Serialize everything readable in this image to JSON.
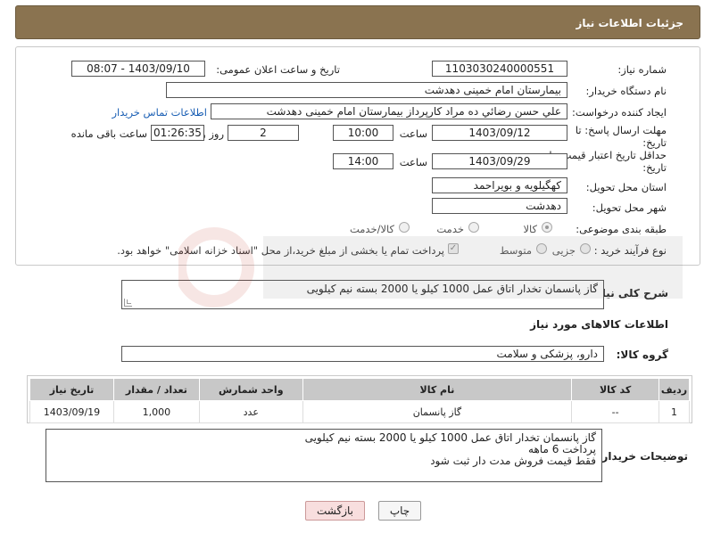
{
  "header": {
    "title": "جزئیات اطلاعات نیاز"
  },
  "form": {
    "need_number_label": "شماره نیاز:",
    "need_number": "1103030240000551",
    "announce_label": "تاریخ و ساعت اعلان عمومی:",
    "announce_value": "1403/09/10 - 08:07",
    "buyer_org_label": "نام دستگاه خریدار:",
    "buyer_org": "بیمارستان امام خمینی دهدشت",
    "creator_label": "ایجاد کننده درخواست:",
    "creator": "علي حسن رضائي ده مراد کارپرداز بیمارستان امام خمینی دهدشت",
    "contact_link": "اطلاعات تماس خریدار",
    "deadline_label": "مهلت ارسال پاسخ: تا",
    "deadline_label2": "تاریخ:",
    "deadline_date": "1403/09/12",
    "time_label": "ساعت",
    "deadline_time": "10:00",
    "days_value": "2",
    "days_label": "روز و",
    "remaining_time": "01:26:35",
    "remaining_label": "ساعت باقی مانده",
    "validity_label": "حداقل تاریخ اعتبار قیمت: تا",
    "validity_label2": "تاریخ:",
    "validity_date": "1403/09/29",
    "validity_time_label": "ساعت",
    "validity_time": "14:00",
    "province_label": "استان محل تحویل:",
    "province": "کهگیلویه و بویراحمد",
    "city_label": "شهر محل تحویل:",
    "city": "دهدشت",
    "category_label": "طبقه بندی موضوعی:",
    "category_options": [
      "کالا",
      "خدمت",
      "کالا/خدمت"
    ],
    "category_selected": "کالا",
    "process_label": "نوع فرآیند خرید :",
    "process_options": [
      "جزیی",
      "متوسط"
    ],
    "payment_note": "پرداخت تمام یا بخشی از مبلغ خرید،از محل \"اسناد خزانه اسلامی\" خواهد بود."
  },
  "description": {
    "label": "شرح کلی نیاز:",
    "text": "گاز پانسمان تخدار اتاق عمل 1000 کیلو یا 2000 بسته نیم کیلویی"
  },
  "goods_section": {
    "title": "اطلاعات کالاهای مورد نیاز",
    "group_label": "گروه کالا:",
    "group_value": "دارو، پزشکی و سلامت"
  },
  "table": {
    "headers": [
      "ردیف",
      "کد کالا",
      "نام کالا",
      "واحد شمارش",
      "تعداد / مقدار",
      "تاریخ نیاز"
    ],
    "rows": [
      [
        "1",
        "--",
        "گاز پانسمان",
        "عدد",
        "1,000",
        "1403/09/19"
      ]
    ]
  },
  "buyer_notes": {
    "label": "توضیحات خریدار:",
    "lines": [
      "گاز پانسمان تخدار اتاق عمل 1000 کیلو یا 2000 بسته نیم کیلویی",
      "پرداخت 6 ماهه",
      "فقط قیمت فروش مدت دار ثبت شود"
    ]
  },
  "buttons": {
    "print": "چاپ",
    "back": "بازگشت"
  },
  "colors": {
    "header_bg": "#8a7350",
    "link": "#1a5fb4",
    "table_header": "#c8c8c8",
    "back_button": "#f8dede"
  }
}
